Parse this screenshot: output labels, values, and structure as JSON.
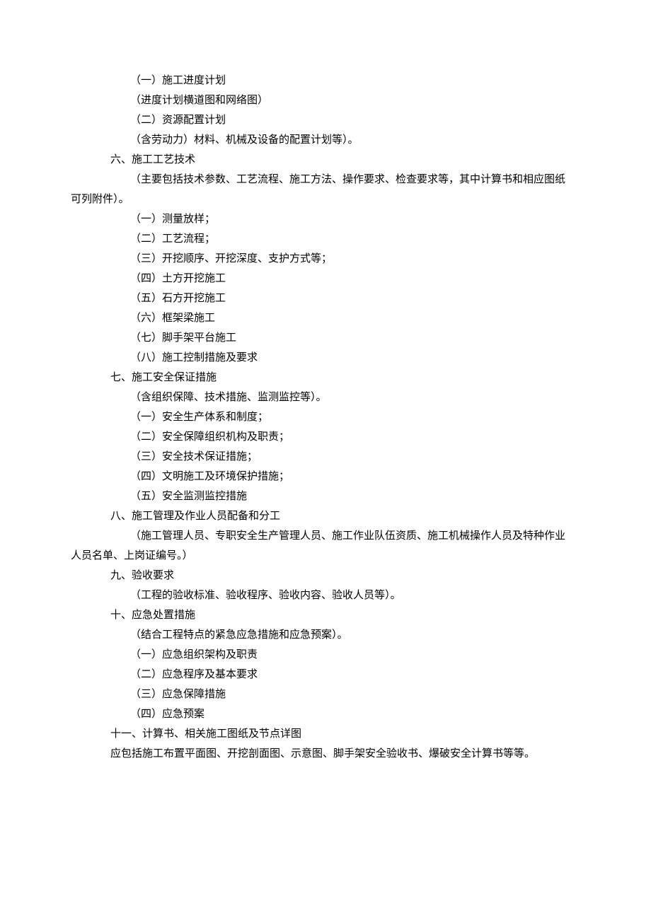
{
  "lines": [
    {
      "indent": "i4",
      "text": "（一）施工进度计划"
    },
    {
      "indent": "i4",
      "text": "（进度计划横道图和网络图）"
    },
    {
      "indent": "i4",
      "text": "（二）资源配置计划"
    },
    {
      "indent": "i4",
      "text": "（含劳动力）材料、机械及设备的配置计划等）。"
    },
    {
      "indent": "i3",
      "text": "六、施工工艺技术"
    },
    {
      "indent": "i4",
      "text": "（主要包括技术参数、工艺流程、施工方法、操作要求、检查要求等，其中计算书和相应图纸"
    },
    {
      "indent": "i1",
      "text": "可列附件）。"
    },
    {
      "indent": "i4",
      "text": "（一）测量放样；"
    },
    {
      "indent": "i4",
      "text": "（二）工艺流程；"
    },
    {
      "indent": "i4",
      "text": "（三）开挖顺序、开挖深度、支护方式等；"
    },
    {
      "indent": "i4",
      "text": "（四）土方开挖施工"
    },
    {
      "indent": "i4",
      "text": "（五）石方开挖施工"
    },
    {
      "indent": "i4",
      "text": "（六）框架梁施工"
    },
    {
      "indent": "i4",
      "text": "（七）脚手架平台施工"
    },
    {
      "indent": "i4",
      "text": "（八）施工控制措施及要求"
    },
    {
      "indent": "i3",
      "text": "七、施工安全保证措施"
    },
    {
      "indent": "i4",
      "text": "（含组织保障、技术措施、监测监控等）。"
    },
    {
      "indent": "i4",
      "text": "（一）安全生产体系和制度；"
    },
    {
      "indent": "i4",
      "text": "（二）安全保障组织机构及职责；"
    },
    {
      "indent": "i4",
      "text": "（三）安全技术保证措施；"
    },
    {
      "indent": "i4",
      "text": "（四）文明施工及环境保护措施；"
    },
    {
      "indent": "i4",
      "text": "（五）安全监测监控措施"
    },
    {
      "indent": "i3",
      "text": "八、施工管理及作业人员配备和分工"
    },
    {
      "indent": "i4",
      "text": "（施工管理人员、专职安全生产管理人员、施工作业队伍资质、施工机械操作人员及特种作业"
    },
    {
      "indent": "i1",
      "text": "人员名单、上岗证编号。）"
    },
    {
      "indent": "i3",
      "text": "九、验收要求"
    },
    {
      "indent": "i4",
      "text": "（工程的验收标准、验收程序、验收内容、验收人员等）。"
    },
    {
      "indent": "i3",
      "text": "十、应急处置措施"
    },
    {
      "indent": "i4",
      "text": "（结合工程特点的紧急应急措施和应急预案）。"
    },
    {
      "indent": "i4",
      "text": "（一）应急组织架构及职责"
    },
    {
      "indent": "i4",
      "text": "（二）应急程序及基本要求"
    },
    {
      "indent": "i4",
      "text": "（三）应急保障措施"
    },
    {
      "indent": "i4",
      "text": "（四）应急预案"
    },
    {
      "indent": "i3",
      "text": "十一、计算书、相关施工图纸及节点详图"
    },
    {
      "indent": "i3",
      "text": "应包括施工布置平面图、开挖剖面图、示意图、脚手架安全验收书、爆破安全计算书等等。"
    }
  ]
}
